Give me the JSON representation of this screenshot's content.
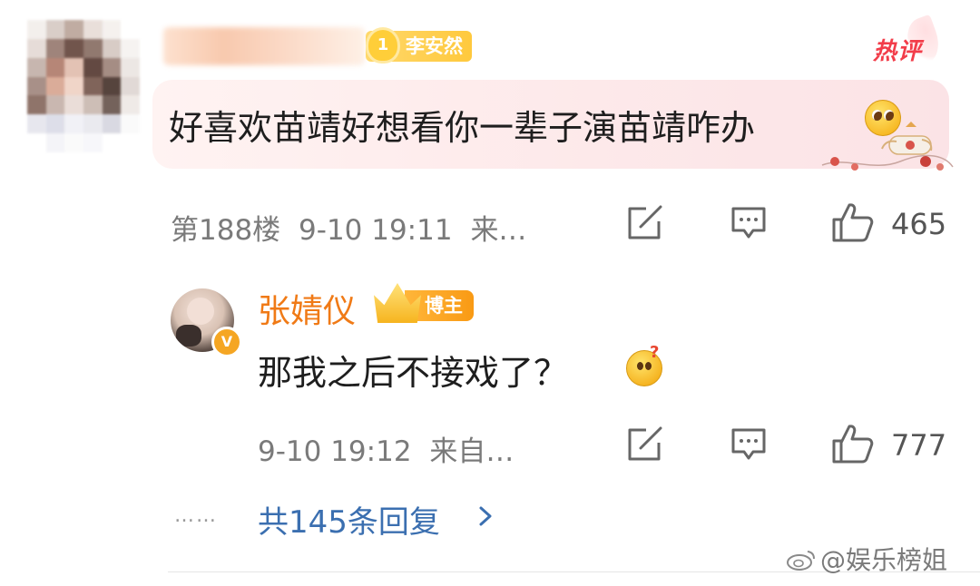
{
  "comment": {
    "fan_badge": "李安然",
    "fan_level": "1",
    "hot_tag": "热评",
    "text": "好喜欢苗靖好想看你一辈子演苗靖咋办",
    "emoji_icon": "pray-emoji",
    "floor": "第188楼",
    "time": "9-10 19:11",
    "source": "来…",
    "like_count": "465"
  },
  "reply": {
    "author": "张婧仪",
    "author_badge": "博主",
    "verified_mark": "V",
    "text": "那我之后不接戏了？",
    "emoji_icon": "thinking-emoji",
    "emoji_mark": "?",
    "time": "9-10 19:12",
    "source": "来自…",
    "like_count": "777"
  },
  "thread": {
    "dots": "……",
    "more_replies": "共145条回复"
  },
  "watermark": "@娱乐榜姐",
  "colors": {
    "accent_orange": "#f07a16",
    "hot_red": "#f23d4a",
    "link_blue": "#3b6fb0",
    "fan_gold": "#ffc93d"
  }
}
